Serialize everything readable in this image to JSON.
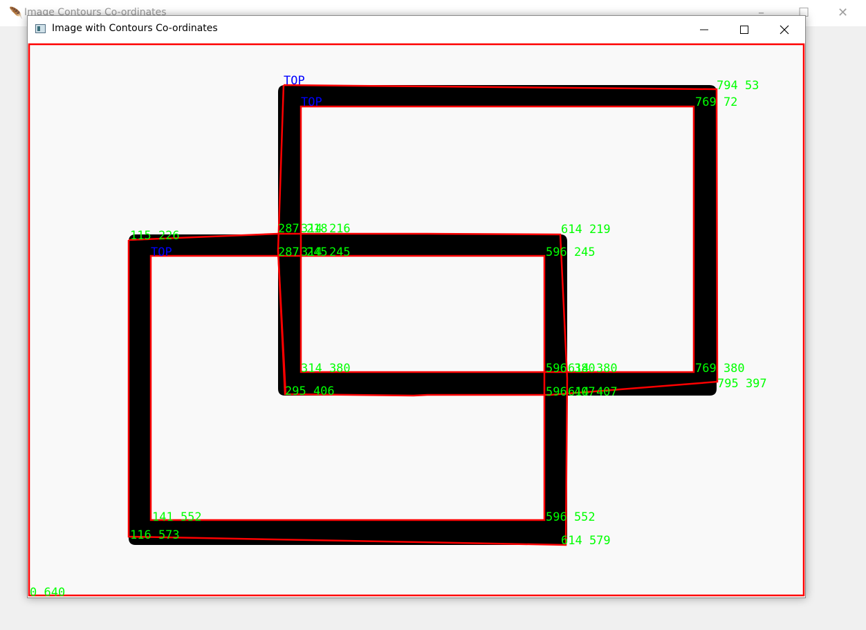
{
  "background_window": {
    "title": "Image Contours Co-ordinates"
  },
  "window": {
    "title": "Image with Contours Co-ordinates",
    "icons": {
      "app": "app-window-icon",
      "minimize": "minimize-icon",
      "maximize": "maximize-icon",
      "close": "close-icon"
    }
  },
  "image": {
    "colors": {
      "background": "#f9f9f9",
      "shape": "#000000",
      "contour": "#ff0000",
      "coordinate_label": "#00ff00",
      "top_label": "#0000ff"
    },
    "top_labels": [
      "TOP",
      "TOP",
      "TOP"
    ],
    "coordinate_labels": [
      "794 53",
      "769 72",
      "287 218",
      "314 216",
      "614 219",
      "115 226",
      "287 245",
      "314 245",
      "596 245",
      "314 380",
      "596 380",
      "614 380",
      "769 380",
      "795 397",
      "295 406",
      "596 407",
      "614 407",
      "141 552",
      "596 552",
      "116 573",
      "614 579",
      "0 640"
    ]
  }
}
